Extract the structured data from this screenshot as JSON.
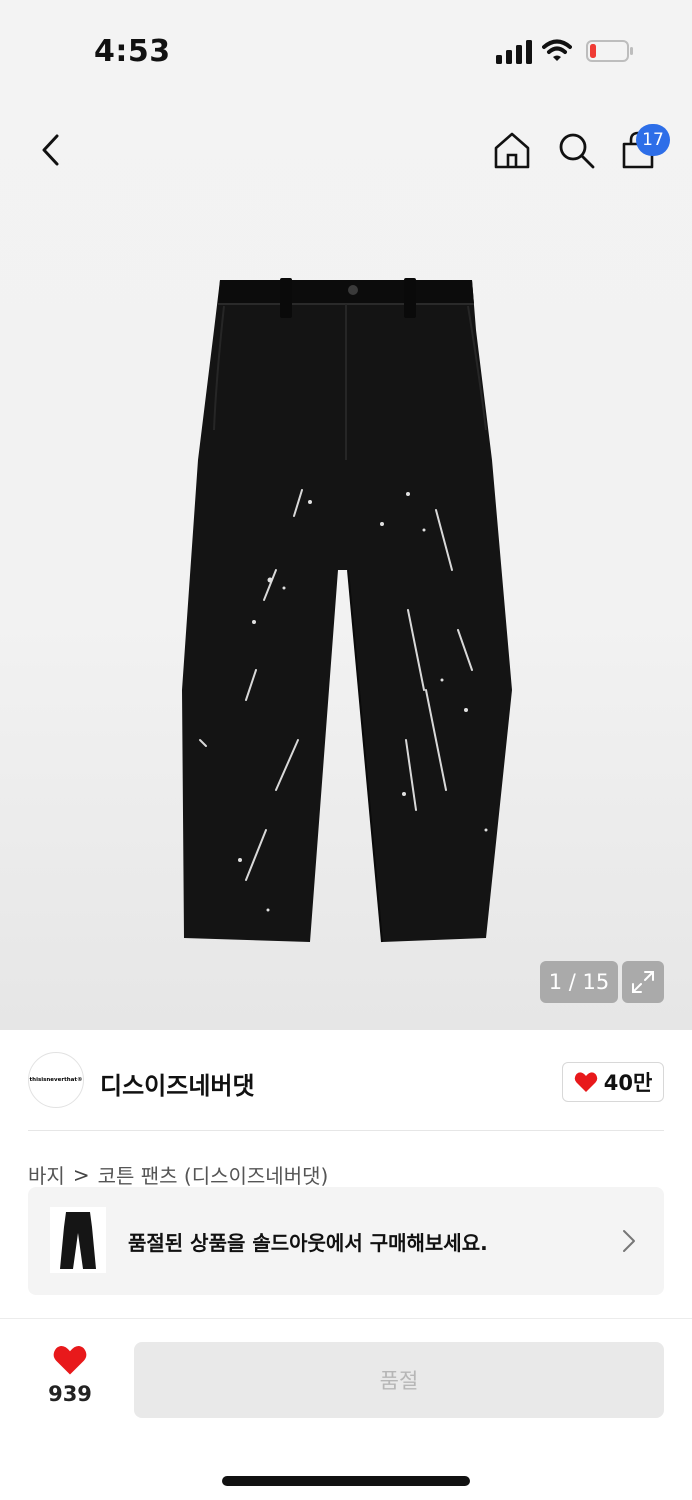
{
  "status_bar": {
    "time": "4:53"
  },
  "nav": {
    "cart_count": "17"
  },
  "gallery": {
    "counter": "1 / 15"
  },
  "brand": {
    "logo_text": "thisisneverthat®",
    "name": "디스이즈네버댓",
    "likes": "40만"
  },
  "breadcrumb": {
    "category": "바지",
    "separator": ">",
    "product": "코튼 팬츠 (디스이즈네버댓)"
  },
  "promo": {
    "text": "품절된 상품을 솔드아웃에서 구매해보세요."
  },
  "bottom": {
    "wish_count": "939",
    "action_label": "품절"
  },
  "colors": {
    "badge": "#2d6ee8",
    "heart": "#e8191b",
    "battery_low": "#ef3b34"
  },
  "icons": [
    "back-icon",
    "home-icon",
    "search-icon",
    "shopping-bag-icon",
    "expand-icon",
    "heart-icon",
    "chevron-right-icon"
  ]
}
